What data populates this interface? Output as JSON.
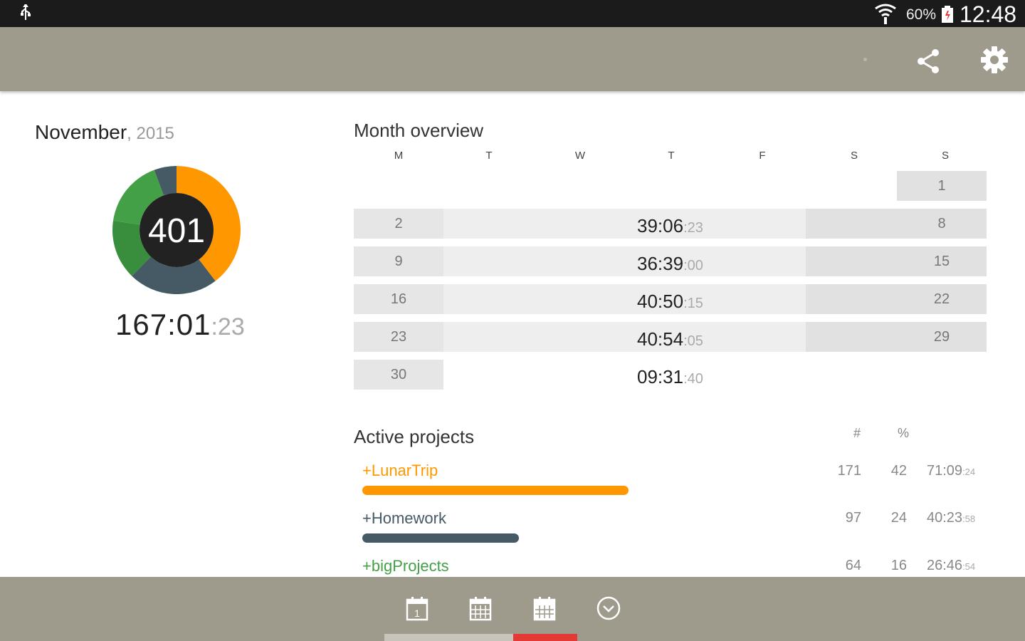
{
  "status_bar": {
    "battery": "60%",
    "time": "12:48",
    "icons": [
      "usb-icon",
      "wifi-icon",
      "battery-icon"
    ]
  },
  "action_bar": {
    "color": "#9e9b8c",
    "actions": [
      "share-icon",
      "settings-icon"
    ]
  },
  "summary": {
    "month": "November",
    "year": ", 2015",
    "count": "401",
    "total_hm": "167:01",
    "total_sec": ":23",
    "donut_segments": [
      {
        "project": "+LunarTrip",
        "percent": 42,
        "color": "#ff9800"
      },
      {
        "project": "+Homework",
        "percent": 24,
        "color": "#455a64"
      },
      {
        "project": "+bigProjects",
        "percent": 16,
        "color": "#388e3c"
      },
      {
        "project": "other",
        "percent": 18,
        "color": "#43a047"
      },
      {
        "project": "other",
        "percent": 6,
        "color": "#455a64"
      }
    ]
  },
  "month_overview": {
    "title": "Month overview",
    "day_headers": [
      "M",
      "T",
      "W",
      "T",
      "F",
      "S",
      "S"
    ],
    "weeks": [
      {
        "days": [
          "",
          "",
          "",
          "",
          "",
          "",
          "1"
        ],
        "total_hm": "",
        "total_sec": ""
      },
      {
        "days": [
          "2",
          "",
          "",
          "",
          "",
          "",
          "8"
        ],
        "total_hm": "39:06",
        "total_sec": ":23"
      },
      {
        "days": [
          "9",
          "",
          "",
          "",
          "",
          "",
          "15"
        ],
        "total_hm": "36:39",
        "total_sec": ":00"
      },
      {
        "days": [
          "16",
          "",
          "",
          "",
          "",
          "",
          "22"
        ],
        "total_hm": "40:50",
        "total_sec": ":15"
      },
      {
        "days": [
          "23",
          "",
          "",
          "",
          "",
          "",
          "29"
        ],
        "total_hm": "40:54",
        "total_sec": ":05"
      },
      {
        "days": [
          "30",
          "",
          "",
          "",
          "",
          "",
          ""
        ],
        "total_hm": "09:31",
        "total_sec": ":40"
      }
    ]
  },
  "projects": {
    "title": "Active projects",
    "col_count": "#",
    "col_percent": "%",
    "items": [
      {
        "name": "+LunarTrip",
        "color": "#ff9800",
        "count": "171",
        "percent": "42",
        "time_hm": "71:09",
        "time_sec": ":24"
      },
      {
        "name": "+Homework",
        "color": "#455a64",
        "count": "97",
        "percent": "24",
        "time_hm": "40:23",
        "time_sec": ":58"
      },
      {
        "name": "+bigProjects",
        "color": "#43a047",
        "count": "64",
        "percent": "16",
        "time_hm": "26:46",
        "time_sec": ":54"
      }
    ]
  },
  "bottom_nav": {
    "items": [
      "calendar-day-icon",
      "calendar-week-icon",
      "calendar-month-icon",
      "clock-check-icon"
    ],
    "selected_index": 2,
    "indicator_color": "#e53935"
  }
}
